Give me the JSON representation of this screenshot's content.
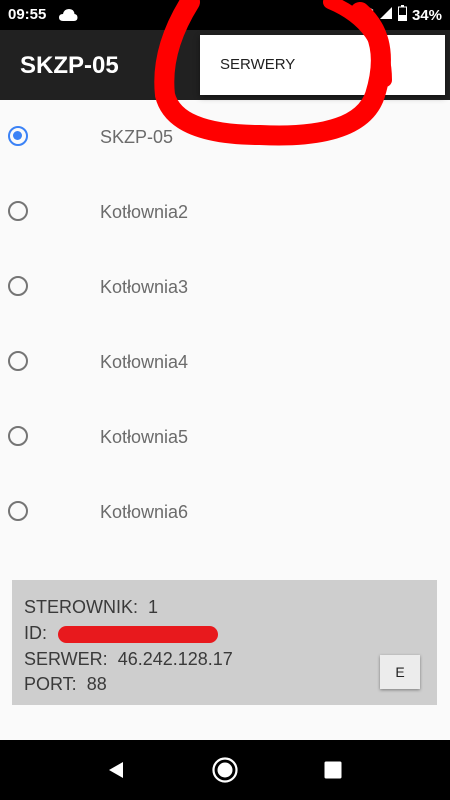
{
  "status_bar": {
    "time": "09:55",
    "battery": "34%"
  },
  "app": {
    "title": "SKZP-05"
  },
  "menu": {
    "items": [
      "SERWERY"
    ]
  },
  "servers": [
    {
      "label": "SKZP-05",
      "selected": true
    },
    {
      "label": "Kotłownia2",
      "selected": false
    },
    {
      "label": "Kotłownia3",
      "selected": false
    },
    {
      "label": "Kotłownia4",
      "selected": false
    },
    {
      "label": "Kotłownia5",
      "selected": false
    },
    {
      "label": "Kotłownia6",
      "selected": false
    }
  ],
  "info": {
    "sterownik_label": "STEROWNIK:",
    "sterownik_value": "1",
    "id_label": "ID:",
    "serwer_label": "SERWER:",
    "serwer_value": "46.242.128.17",
    "port_label": "PORT:",
    "port_value": "88",
    "edit_button": "E"
  },
  "colors": {
    "accent": "#3b82f6",
    "scribble": "#ff0000",
    "app_bar": "#212121",
    "panel": "#cecece"
  },
  "icons": [
    "cloud-icon",
    "wifi-icon",
    "battery-icon",
    "back-icon",
    "home-icon",
    "recents-icon"
  ]
}
